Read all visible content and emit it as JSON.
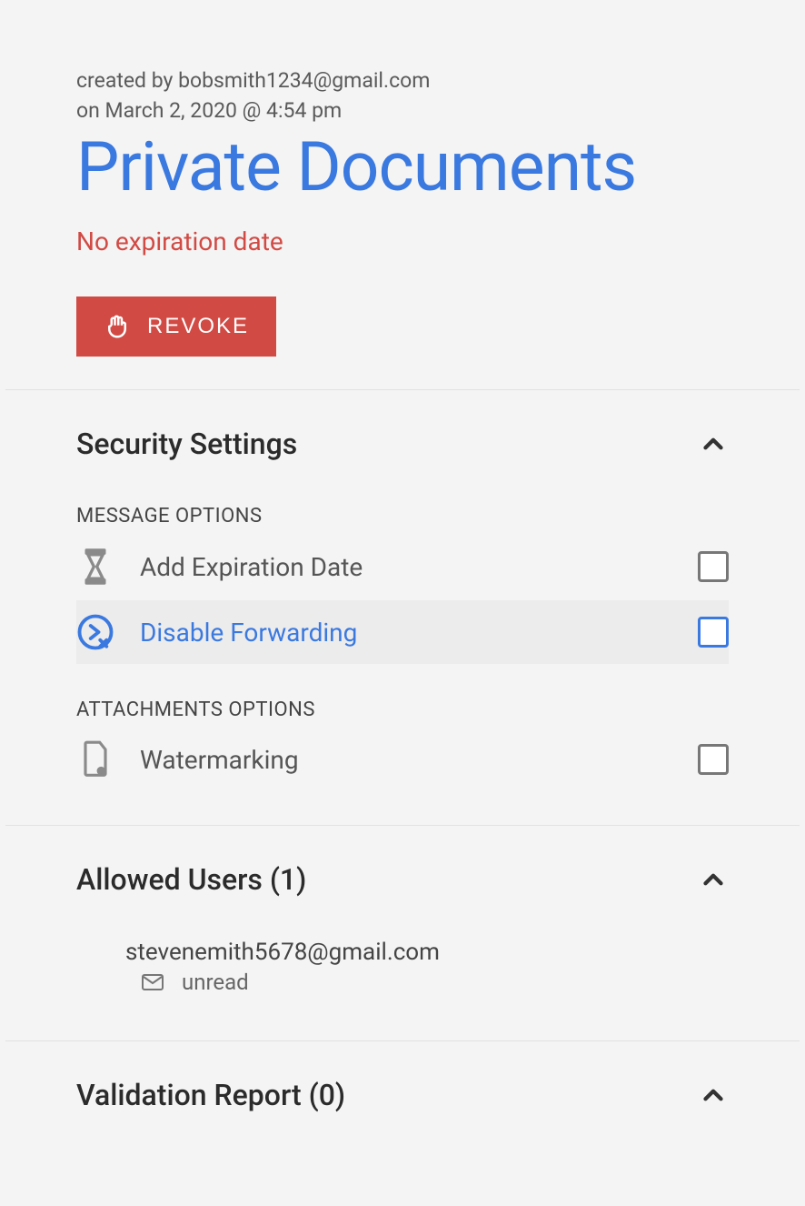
{
  "header": {
    "created_by_prefix": "created by ",
    "created_by_email": "bobsmith1234@gmail.com",
    "created_on_prefix": "on ",
    "created_on": "March 2, 2020 @ 4:54 pm",
    "title": "Private Documents",
    "expiration": "No expiration date",
    "revoke_label": "REVOKE"
  },
  "security": {
    "title": "Security Settings",
    "message_options_label": "MESSAGE OPTIONS",
    "attachments_options_label": "ATTACHMENTS OPTIONS",
    "options": {
      "add_expiration": {
        "label": "Add Expiration Date",
        "checked": false
      },
      "disable_forwarding": {
        "label": "Disable Forwarding",
        "checked": false,
        "highlighted": true
      },
      "watermarking": {
        "label": "Watermarking",
        "checked": false
      }
    }
  },
  "allowed_users": {
    "title": "Allowed Users (1)",
    "users": [
      {
        "email": "stevenemith5678@gmail.com",
        "status": "unread"
      }
    ]
  },
  "validation": {
    "title": "Validation Report (0)"
  },
  "colors": {
    "accent_blue": "#3a79e0",
    "danger_red": "#d14a44",
    "gray_text": "#5a5a5a"
  }
}
